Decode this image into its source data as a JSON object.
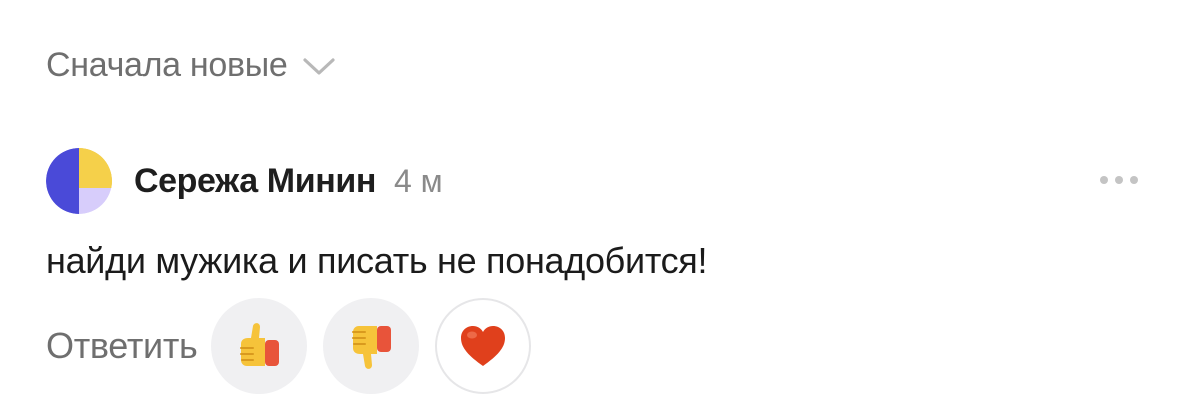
{
  "sort": {
    "label": "Сначала новые",
    "icon": "chevron-down-icon"
  },
  "comment": {
    "author": "Сережа Минин",
    "time": "4 м",
    "text": "найди мужика и писать не понадобится!",
    "avatar": {
      "colors": [
        "#4a4ad8",
        "#f5d04a",
        "#d7cdfb"
      ]
    }
  },
  "actions": {
    "reply_label": "Ответить",
    "reactions": [
      {
        "name": "thumbs-up",
        "icon": "thumbs-up-icon"
      },
      {
        "name": "thumbs-down",
        "icon": "thumbs-down-icon"
      },
      {
        "name": "heart",
        "icon": "heart-icon"
      }
    ]
  },
  "colors": {
    "muted_text": "#6f6f6f",
    "main_text": "#1b1b1b",
    "reaction_bg": "#f0f0f2",
    "heart": "#e0401c"
  }
}
